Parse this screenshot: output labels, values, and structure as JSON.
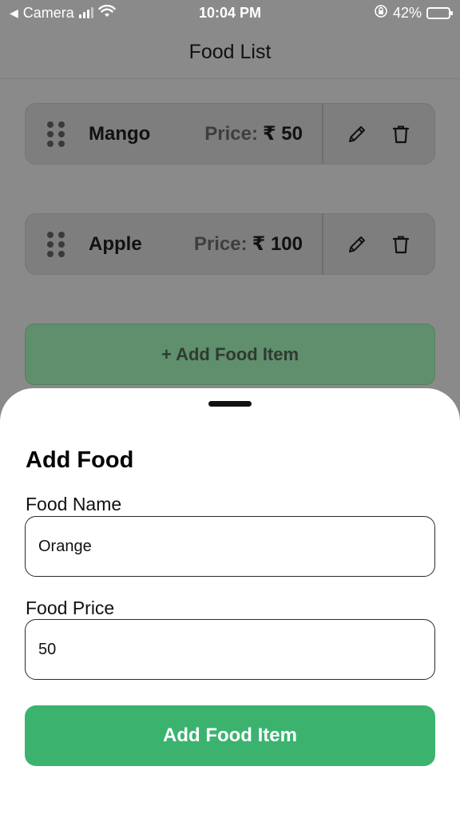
{
  "status_bar": {
    "back_app": "Camera",
    "time": "10:04 PM",
    "battery_percent": "42%",
    "battery_level": 0.42
  },
  "header": {
    "title": "Food List"
  },
  "food_items": [
    {
      "name": "Mango",
      "price_label": "Price:",
      "price_value": "₹ 50"
    },
    {
      "name": "Apple",
      "price_label": "Price:",
      "price_value": "₹ 100"
    }
  ],
  "background_add_button": {
    "label": "+ Add Food Item"
  },
  "sheet": {
    "title": "Add Food",
    "name_label": "Food Name",
    "name_value": "Orange",
    "price_label": "Food Price",
    "price_value": "50",
    "submit_label": "Add Food Item"
  },
  "colors": {
    "accent_green": "#3bb36f",
    "overlay_gray": "#8a8a8a"
  }
}
